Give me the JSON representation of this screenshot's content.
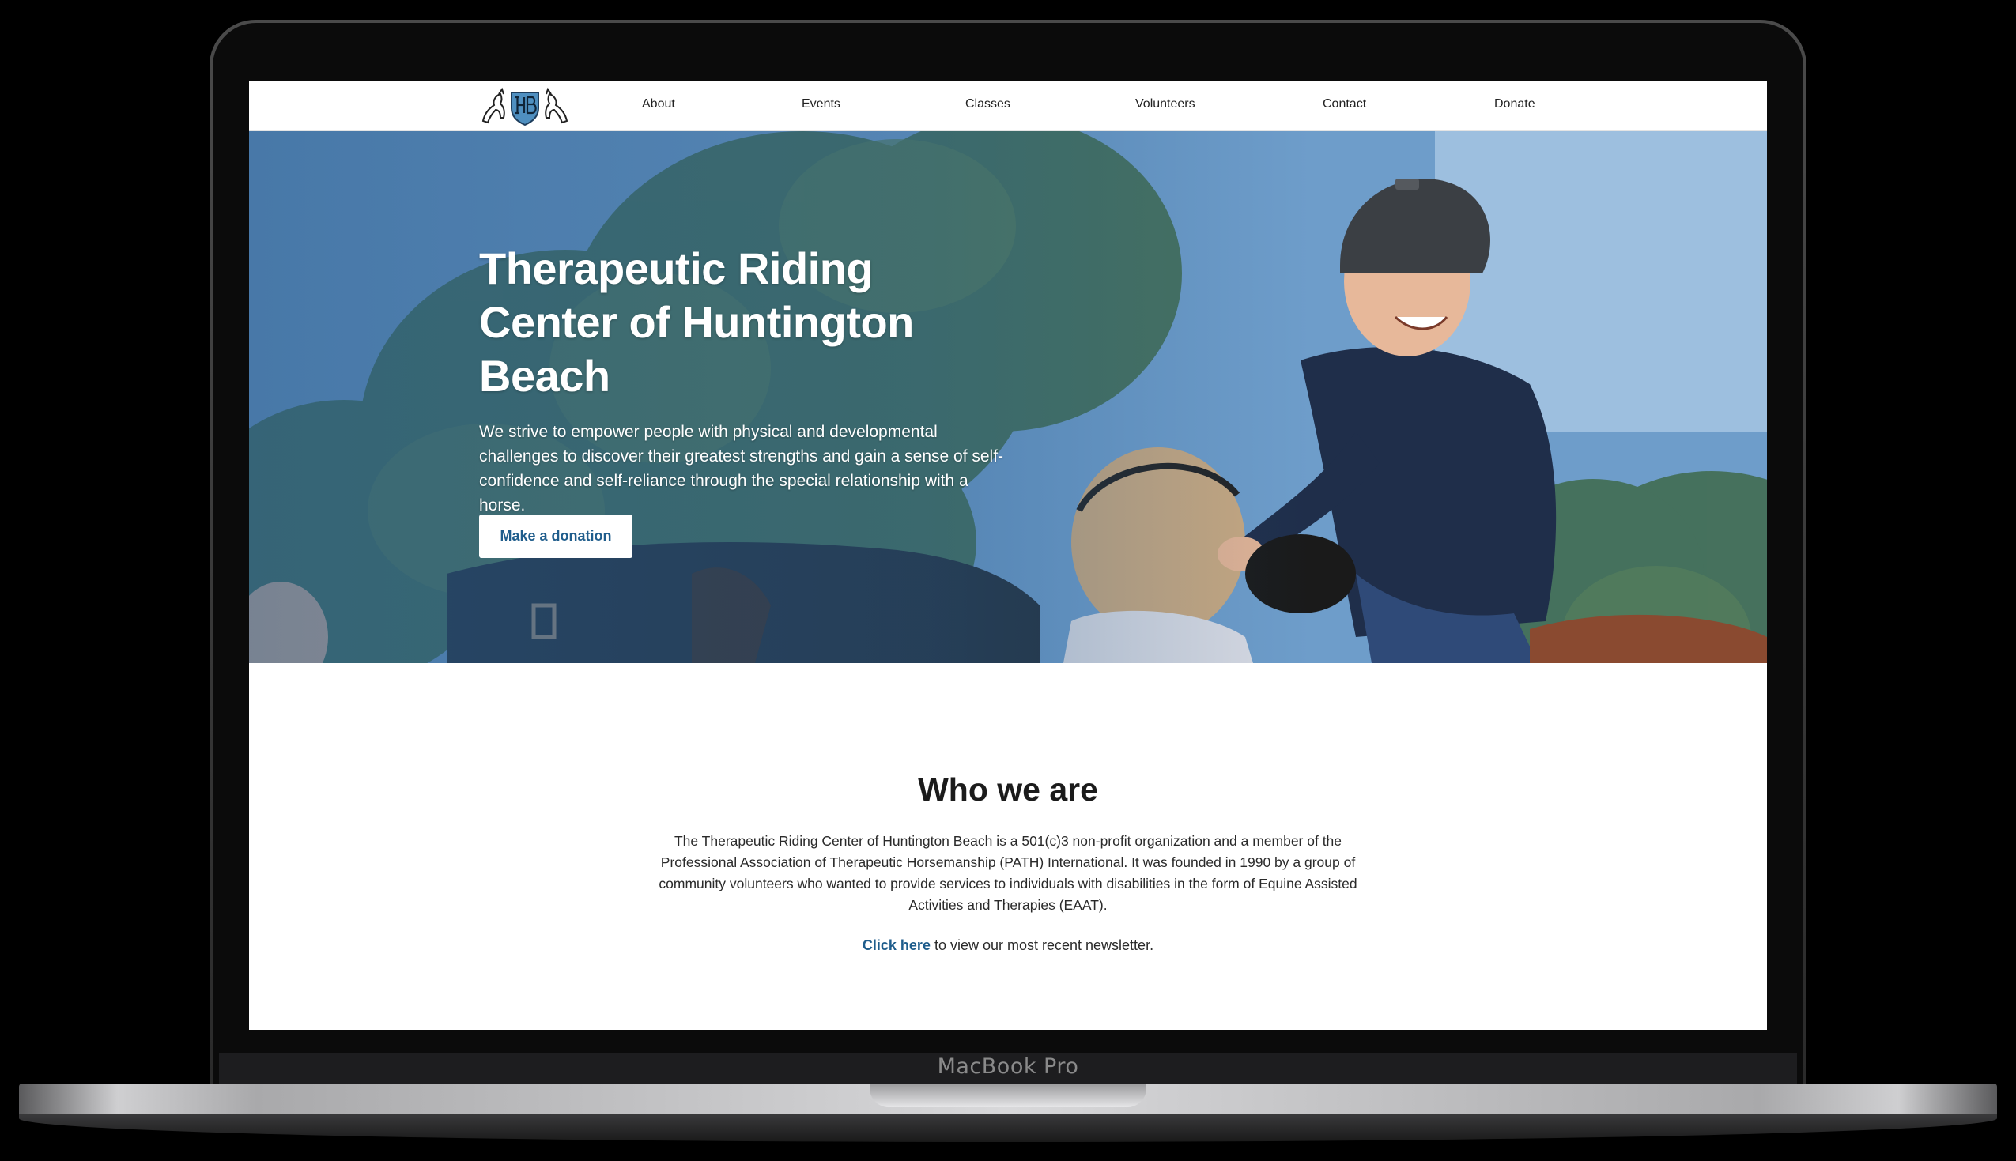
{
  "device": {
    "label": "MacBook Pro"
  },
  "nav": {
    "items": [
      {
        "label": "About"
      },
      {
        "label": "Events"
      },
      {
        "label": "Classes"
      },
      {
        "label": "Volunteers"
      },
      {
        "label": "Contact"
      },
      {
        "label": "Donate"
      }
    ]
  },
  "hero": {
    "title": "Therapeutic Riding Center of Huntington Beach",
    "subtitle": "We strive to empower people with physical and developmental challenges to discover their greatest strengths and gain a sense of self-confidence and self-reliance through the special relationship with a horse.",
    "button_label": "Make a donation"
  },
  "about": {
    "title": "Who we are",
    "body": "The Therapeutic Riding Center of Huntington Beach is a 501(c)3 non-profit organization and a member of the Professional Association of Therapeutic Horsemanship (PATH) International. It was founded in 1990 by a group of community volunteers who wanted to provide services to individuals with disabilities in the form of Equine Assisted Activities and Therapies (EAAT).",
    "newsletter_link": "Click here",
    "newsletter_text": " to view our most recent newsletter."
  },
  "colors": {
    "accent": "#1f5d8c",
    "hero_overlay": "#285a8c"
  }
}
